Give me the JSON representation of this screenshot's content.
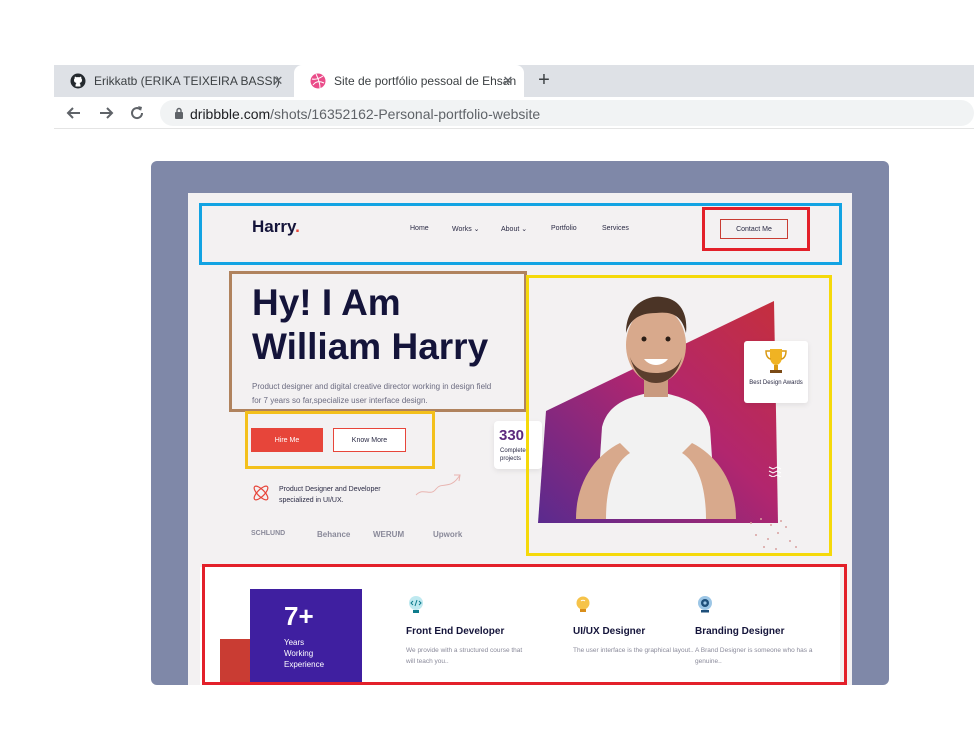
{
  "browser": {
    "tabs": [
      {
        "title": "Erikkatb (ERIKA TEIXEIRA BASSI)",
        "close": "✕"
      },
      {
        "title": "Site de portfólio pessoal de Ehsan",
        "close": "✕"
      }
    ],
    "new_tab": "+",
    "url_host": "dribbble.com",
    "url_path": "/shots/16352162-Personal-portfolio-website"
  },
  "site": {
    "logo": "Harry",
    "logo_dot": ".",
    "nav": [
      "Home",
      "Works ⌄",
      "About ⌄",
      "Portfolio",
      "Services"
    ],
    "contact_label": "Contact Me",
    "hero": {
      "line1": "Hy! I Am",
      "line2": "William Harry",
      "description": "Product designer and digital creative director working in design field for 7 years so far,specialize user interface design.",
      "hire_label": "Hire Me",
      "know_label": "Know More"
    },
    "product_designer": "Product Designer and Developer specialized in UI/UX.",
    "brands": [
      "SCHLUND",
      "Behance",
      "WERUM",
      "Upwork"
    ],
    "projects": {
      "count": "330",
      "label": "Completed projects"
    },
    "award": "Best Design Awards",
    "experience": {
      "number": "7+",
      "label_1": "Years",
      "label_2": "Working",
      "label_3": "Experience"
    },
    "services": [
      {
        "title": "Front End Developer",
        "desc": "We provide with a structured course that will teach you..",
        "icon": "code-bulb-icon"
      },
      {
        "title": "UI/UX Designer",
        "desc": "The user interface is the graphical layout..",
        "icon": "lightbulb-icon"
      },
      {
        "title": "Branding Designer",
        "desc": "A Brand Designer is someone who has a genuine..",
        "icon": "webcam-icon"
      }
    ]
  },
  "colors": {
    "accent_red": "#e7453a",
    "navy": "#14143a",
    "purple": "#3f1fa0",
    "annotation_blue": "#12a3e3",
    "annotation_red": "#e3202a",
    "annotation_brown": "#b0835e",
    "annotation_yellow": "#f5d90a",
    "annotation_orange": "#f3c01c"
  }
}
